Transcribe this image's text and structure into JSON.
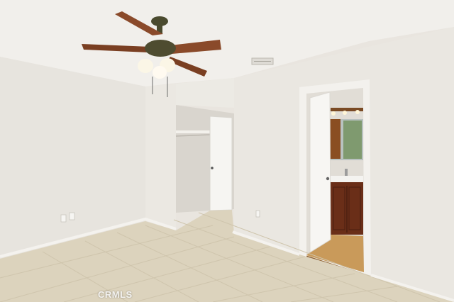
{
  "photo": {
    "watermark": "CRMLS"
  },
  "colors": {
    "wall": "#e9e6e0",
    "ceiling": "#f1efeb",
    "floor_tile": "#dcd3bd",
    "grout": "#cfc5ad",
    "baseboard": "#f4f2ee",
    "door": "#f6f5f2",
    "fan_blade": "#8a4a2a",
    "fan_body": "#4a4a2e",
    "vanity": "#6a2e18",
    "bath_floor": "#c99a5a"
  }
}
